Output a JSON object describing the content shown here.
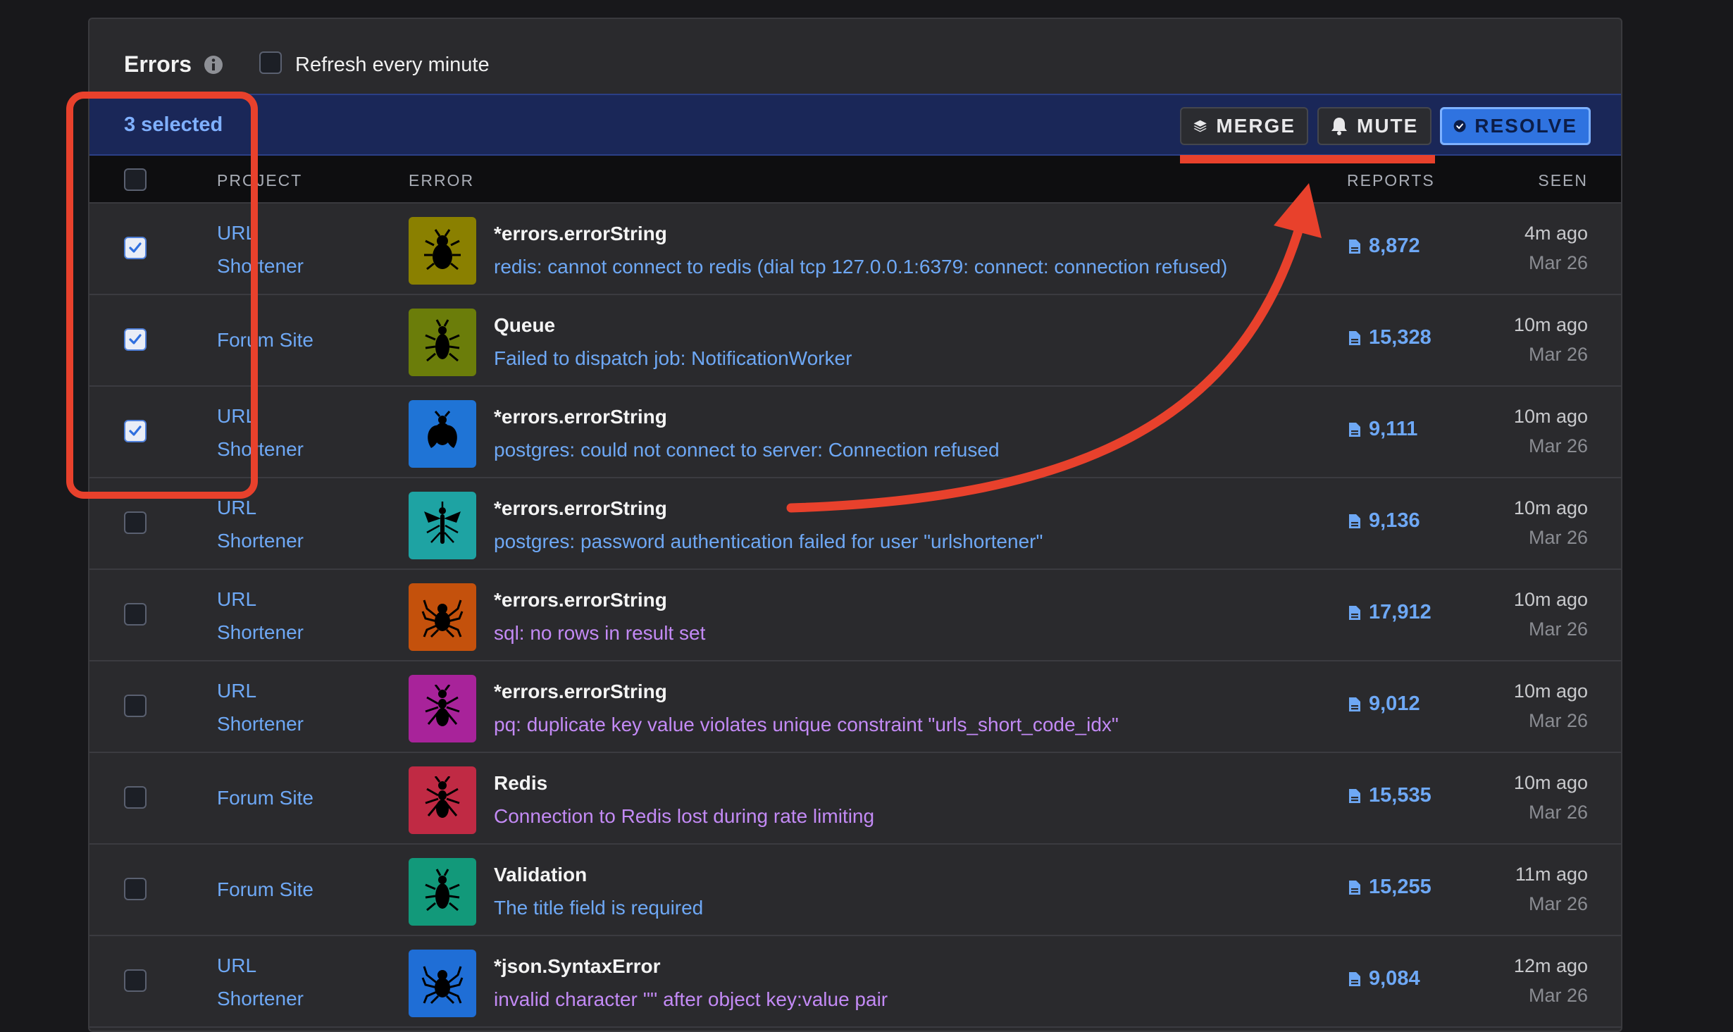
{
  "header": {
    "title": "Errors",
    "refresh_label": "Refresh every minute"
  },
  "selection_bar": {
    "count_label": "3 selected",
    "merge_label": "MERGE",
    "mute_label": "MUTE",
    "resolve_label": "RESOLVE"
  },
  "columns": {
    "project": "PROJECT",
    "error": "ERROR",
    "reports": "REPORTS",
    "seen": "SEEN"
  },
  "rows": [
    {
      "checked": true,
      "project": "URL Shortener",
      "icon": "tick-icon",
      "color": "#8a8000",
      "type": "*errors.errorString",
      "message": "redis: cannot connect to redis (dial tcp 127.0.0.1:6379: connect: connection refused)",
      "msg_color": "#6ea8f5",
      "reports": "8,872",
      "seen": "4m ago",
      "date": "Mar 26"
    },
    {
      "checked": true,
      "project": "Forum Site",
      "icon": "beetle-icon",
      "color": "#6b7d0a",
      "type": "Queue",
      "message": "Failed to dispatch job: NotificationWorker",
      "msg_color": "#6ea8f5",
      "reports": "15,328",
      "seen": "10m ago",
      "date": "Mar 26"
    },
    {
      "checked": true,
      "project": "URL Shortener",
      "icon": "fly-icon",
      "color": "#1f74d6",
      "type": "*errors.errorString",
      "message": "postgres: could not connect to server: Connection refused",
      "msg_color": "#6ea8f5",
      "reports": "9,111",
      "seen": "10m ago",
      "date": "Mar 26"
    },
    {
      "checked": false,
      "project": "URL Shortener",
      "icon": "mosquito-icon",
      "color": "#1ea3a3",
      "type": "*errors.errorString",
      "message": "postgres: password authentication failed for user \"urlshortener\"",
      "msg_color": "#6ea8f5",
      "reports": "9,136",
      "seen": "10m ago",
      "date": "Mar 26"
    },
    {
      "checked": false,
      "project": "URL Shortener",
      "icon": "spider-icon",
      "color": "#c4510c",
      "type": "*errors.errorString",
      "message": "sql: no rows in result set",
      "msg_color": "#c38af5",
      "reports": "17,912",
      "seen": "10m ago",
      "date": "Mar 26"
    },
    {
      "checked": false,
      "project": "URL Shortener",
      "icon": "ant-icon",
      "color": "#a8239a",
      "type": "*errors.errorString",
      "message": "pq: duplicate key value violates unique constraint \"urls_short_code_idx\"",
      "msg_color": "#c38af5",
      "reports": "9,012",
      "seen": "10m ago",
      "date": "Mar 26"
    },
    {
      "checked": false,
      "project": "Forum Site",
      "icon": "ant-icon",
      "color": "#c02a44",
      "type": "Redis",
      "message": "Connection to Redis lost during rate limiting",
      "msg_color": "#c38af5",
      "reports": "15,535",
      "seen": "10m ago",
      "date": "Mar 26"
    },
    {
      "checked": false,
      "project": "Forum Site",
      "icon": "beetle-icon",
      "color": "#12997a",
      "type": "Validation",
      "message": "The title field is required",
      "msg_color": "#6ea8f5",
      "reports": "15,255",
      "seen": "11m ago",
      "date": "Mar 26"
    },
    {
      "checked": false,
      "project": "URL Shortener",
      "icon": "spider-icon",
      "color": "#1f6ed6",
      "type": "*json.SyntaxError",
      "message": "invalid character '\"' after object key:value pair",
      "msg_color": "#c38af5",
      "reports": "9,084",
      "seen": "12m ago",
      "date": "Mar 26"
    }
  ],
  "colors": {
    "annotation": "#e8412c",
    "accent": "#2f73e0",
    "link": "#6ea8f5"
  }
}
